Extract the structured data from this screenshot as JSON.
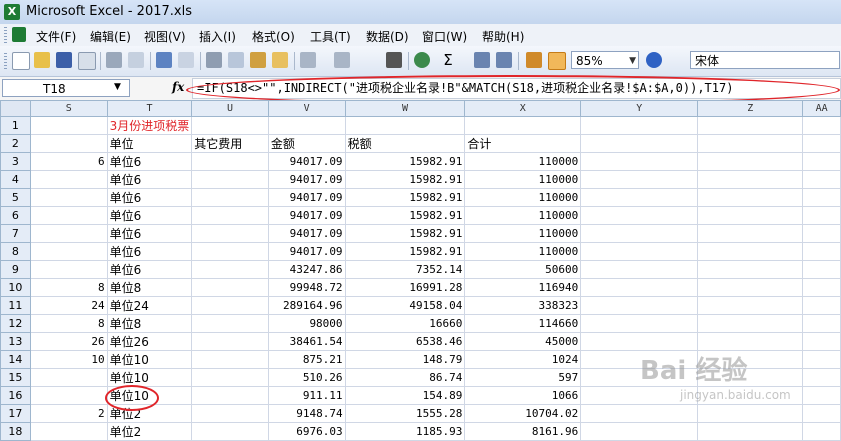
{
  "window": {
    "title": "Microsoft Excel - 2017.xls",
    "app_icon": "excel-icon"
  },
  "menu": [
    {
      "label": "文件(F)"
    },
    {
      "label": "编辑(E)"
    },
    {
      "label": "视图(V)"
    },
    {
      "label": "插入(I)"
    },
    {
      "label": "格式(O)"
    },
    {
      "label": "工具(T)"
    },
    {
      "label": "数据(D)"
    },
    {
      "label": "窗口(W)"
    },
    {
      "label": "帮助(H)"
    }
  ],
  "toolbar": {
    "zoom": "85%",
    "font": "宋体",
    "sigma": "Σ"
  },
  "formula_bar": {
    "name_box": "T18",
    "fx": "fx",
    "formula": "=IF(S18<>\"\",INDIRECT(\"进项税企业名录!B\"&MATCH(S18,进项税企业名录!$A:$A,0)),T17)"
  },
  "columns": [
    "S",
    "T",
    "U",
    "V",
    "W",
    "X",
    "Y",
    "Z",
    "AA"
  ],
  "rows": [
    {
      "n": "1",
      "S": "",
      "T": "3月份进项税票",
      "U": "",
      "V": "",
      "W": "",
      "X": ""
    },
    {
      "n": "2",
      "S": "",
      "T": "单位",
      "U": "其它费用",
      "V": "金额",
      "W": "税额",
      "X": "合计"
    },
    {
      "n": "3",
      "S": "6",
      "T": "单位6",
      "U": "",
      "V": "94017.09",
      "W": "15982.91",
      "X": "110000"
    },
    {
      "n": "4",
      "S": "",
      "T": "单位6",
      "U": "",
      "V": "94017.09",
      "W": "15982.91",
      "X": "110000"
    },
    {
      "n": "5",
      "S": "",
      "T": "单位6",
      "U": "",
      "V": "94017.09",
      "W": "15982.91",
      "X": "110000"
    },
    {
      "n": "6",
      "S": "",
      "T": "单位6",
      "U": "",
      "V": "94017.09",
      "W": "15982.91",
      "X": "110000"
    },
    {
      "n": "7",
      "S": "",
      "T": "单位6",
      "U": "",
      "V": "94017.09",
      "W": "15982.91",
      "X": "110000"
    },
    {
      "n": "8",
      "S": "",
      "T": "单位6",
      "U": "",
      "V": "94017.09",
      "W": "15982.91",
      "X": "110000"
    },
    {
      "n": "9",
      "S": "",
      "T": "单位6",
      "U": "",
      "V": "43247.86",
      "W": "7352.14",
      "X": "50600"
    },
    {
      "n": "10",
      "S": "8",
      "T": "单位8",
      "U": "",
      "V": "99948.72",
      "W": "16991.28",
      "X": "116940"
    },
    {
      "n": "11",
      "S": "24",
      "T": "单位24",
      "U": "",
      "V": "289164.96",
      "W": "49158.04",
      "X": "338323"
    },
    {
      "n": "12",
      "S": "8",
      "T": "单位8",
      "U": "",
      "V": "98000",
      "W": "16660",
      "X": "114660"
    },
    {
      "n": "13",
      "S": "26",
      "T": "单位26",
      "U": "",
      "V": "38461.54",
      "W": "6538.46",
      "X": "45000"
    },
    {
      "n": "14",
      "S": "10",
      "T": "单位10",
      "U": "",
      "V": "875.21",
      "W": "148.79",
      "X": "1024"
    },
    {
      "n": "15",
      "S": "",
      "T": "单位10",
      "U": "",
      "V": "510.26",
      "W": "86.74",
      "X": "597"
    },
    {
      "n": "16",
      "S": "",
      "T": "单位10",
      "U": "",
      "V": "911.11",
      "W": "154.89",
      "X": "1066"
    },
    {
      "n": "17",
      "S": "2",
      "T": "单位2",
      "U": "",
      "V": "9148.74",
      "W": "1555.28",
      "X": "10704.02"
    },
    {
      "n": "18",
      "S": "",
      "T": "单位2",
      "U": "",
      "V": "6976.03",
      "W": "1185.93",
      "X": "8161.96"
    }
  ],
  "watermark": {
    "main": "Bai 经验",
    "sub": "jingyan.baidu.com"
  },
  "colors": {
    "annotation": "#e0252a",
    "header_bg": "#e4ecf7"
  }
}
